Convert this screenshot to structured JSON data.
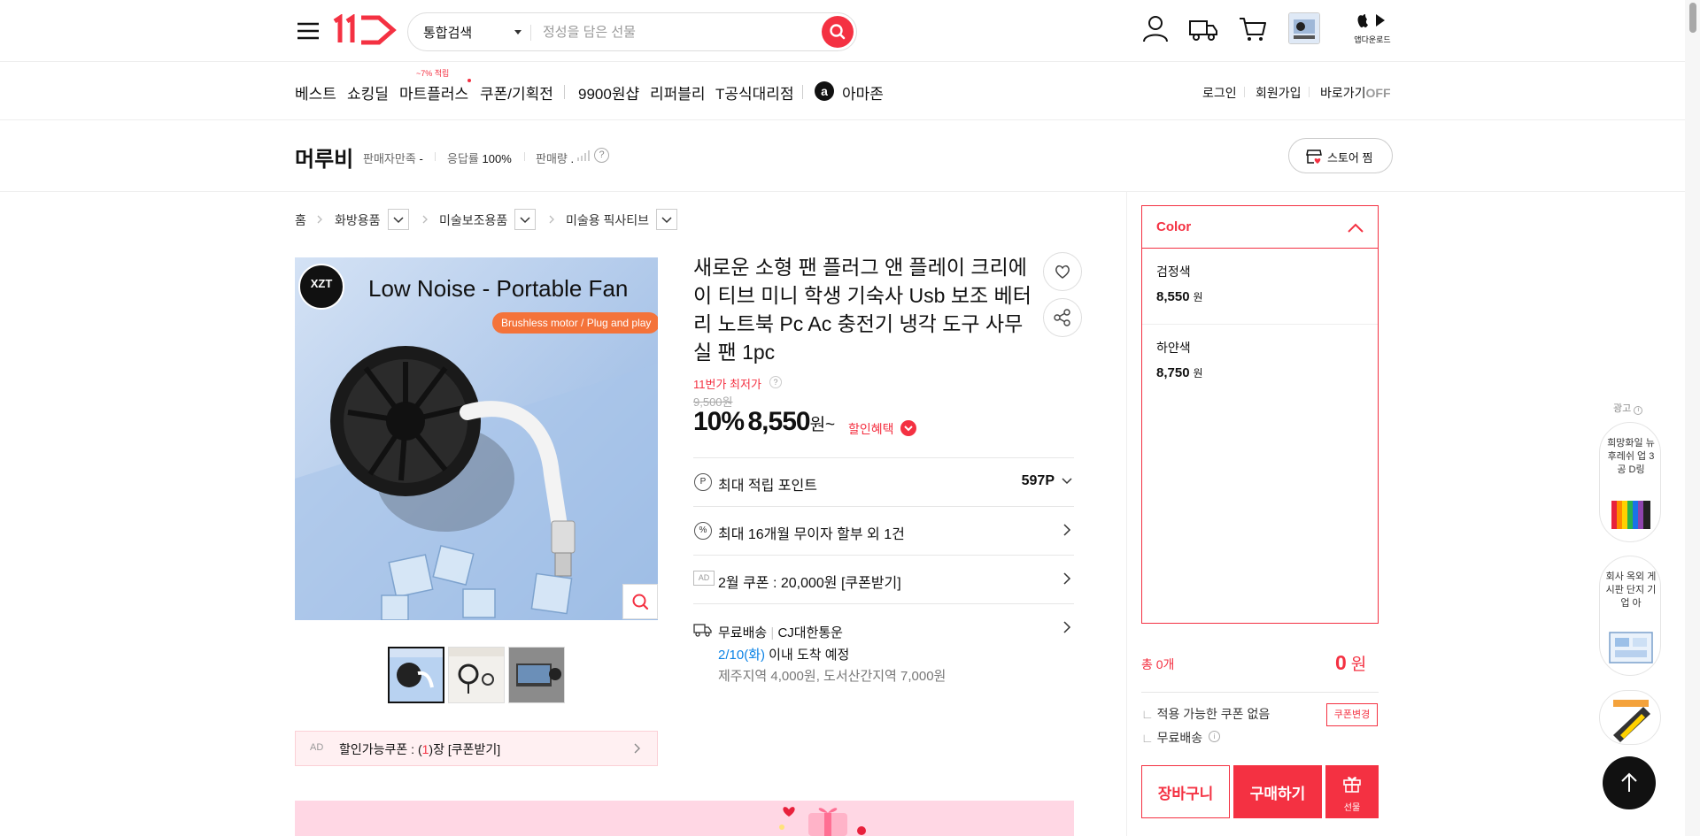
{
  "header": {
    "search_category": "통합검색",
    "search_placeholder": "정성을 담은 선물",
    "app_download_label": "앱다운로드"
  },
  "nav": {
    "items": [
      "베스트",
      "쇼킹딜",
      "마트플러스",
      "쿠폰/기획전",
      "9900원샵",
      "리퍼블리",
      "T공식대리점",
      "아마존"
    ],
    "mart_badge": "~7% 적립",
    "right": [
      "로그인",
      "회원가입",
      "바로가기"
    ],
    "shortcut_state": "OFF"
  },
  "store": {
    "name": "머루비",
    "satisfaction_label": "판매자만족",
    "satisfaction_value": "-",
    "response_label": "응답률",
    "response_value": "100%",
    "sales_label": "판매량",
    "sales_value": ".",
    "fav_button": "스토어 찜"
  },
  "breadcrumb": [
    "홈",
    "화방용품",
    "미술보조용품",
    "미술용 픽사티브"
  ],
  "product": {
    "image_headline": "Low Noise - Portable Fan",
    "image_tag": "Brushless motor / Plug and play",
    "image_brand": "XZT",
    "title": "새로운 소형 팬 플러그 앤 플레이 크리에이 티브 미니 학생 기숙사 Usb 보조 베터리 노트북 Pc Ac 충전기 냉각 도구 사무실 팬 1pc",
    "lowest_label": "11번가 최저가",
    "original_price": "9,500원",
    "discount_rate": "10%",
    "sale_price": "8,550",
    "price_unit": "원~",
    "discount_link": "할인혜택",
    "coupon_box_ad": "AD",
    "coupon_box_text_pre": "할인가능쿠폰 : (",
    "coupon_box_count": "1",
    "coupon_box_text_post": ")장 [쿠폰받기]",
    "thumbnail_count": 3
  },
  "benefits": {
    "points_label": "최대 적립 포인트",
    "points_value": "597P",
    "installment_label": "최대 16개월 무이자 할부 외 1건",
    "coupon_ad": "AD",
    "coupon_label": "2월 쿠폰 : 20,000원 [쿠폰받기]",
    "shipping_type": "무료배송",
    "shipping_carrier": "CJ대한통운",
    "arrival_date": "2/10(화)",
    "arrival_text": "이내 도착 예정",
    "extra_fee": "제주지역 4,000원, 도서산간지역 7,000원"
  },
  "options": {
    "header": "Color",
    "items": [
      {
        "name": "검정색",
        "price": "8,550",
        "unit": "원"
      },
      {
        "name": "하얀색",
        "price": "8,750",
        "unit": "원"
      }
    ]
  },
  "order": {
    "total_label": "총 0개",
    "total_value": "0",
    "total_unit": "원",
    "coupon_status": "적용 가능한 쿠폰 없음",
    "coupon_change": "쿠폰변경",
    "shipping": "무료배송",
    "cart_button": "장바구니",
    "buy_button": "구매하기",
    "gift_button": "선물"
  },
  "side_ads": {
    "label": "광고",
    "items": [
      "희망화일 뉴 후레쉬 업 3공 D링",
      "회사 옥외 게시판 단지 기업 아"
    ]
  },
  "colors": {
    "brand_red": "#f43142",
    "link_blue": "#0b83e6",
    "image_bg": "#b8d2f1",
    "promo_pink": "#ffd7e4"
  }
}
